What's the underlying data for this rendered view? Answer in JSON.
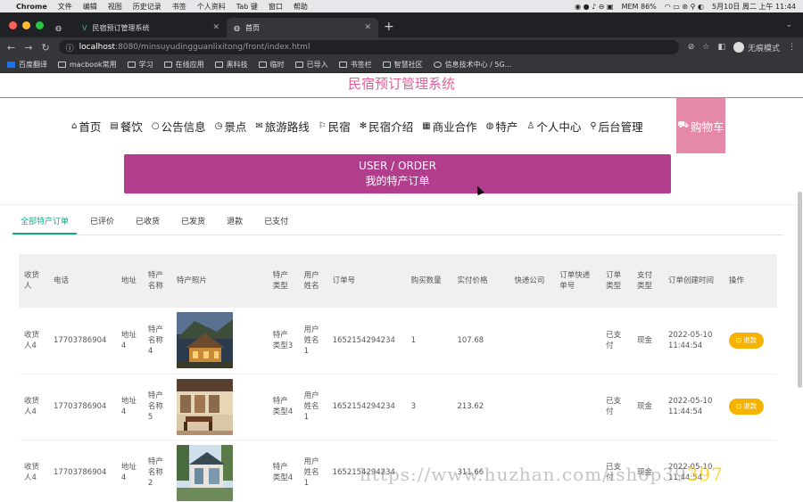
{
  "macbar": {
    "app": "Chrome",
    "menus": [
      "文件",
      "编辑",
      "视图",
      "历史记录",
      "书签",
      "个人资料",
      "Tab 键",
      "窗口",
      "帮助"
    ],
    "battery": "MEM 86%",
    "datetime": "5月10日 周二 上午 11:44"
  },
  "browser": {
    "tabs": [
      {
        "label": "民宿预订管理系统",
        "active": false
      },
      {
        "label": "首页",
        "active": true
      }
    ],
    "url_host": "localhost",
    "url_path": ":8080/minsuyudingguanlixitong/front/index.html",
    "incognito_label": "无痕模式",
    "bookmarks": [
      "百度翻译",
      "macbook常用",
      "学习",
      "在线应用",
      "黑科技",
      "临时",
      "已导入",
      "书签栏",
      "智慧社区",
      "信息技术中心 / 5G..."
    ]
  },
  "site": {
    "title": "民宿预订管理系统",
    "nav": [
      {
        "icon": "home-icon",
        "glyph": "⌂",
        "label": "首页"
      },
      {
        "icon": "food-icon",
        "glyph": "▤",
        "label": "餐饮"
      },
      {
        "icon": "notice-icon",
        "glyph": "○",
        "label": "公告信息"
      },
      {
        "icon": "scenic-icon",
        "glyph": "◷",
        "label": "景点"
      },
      {
        "icon": "route-icon",
        "glyph": "✉",
        "label": "旅游路线"
      },
      {
        "icon": "homestay-icon",
        "glyph": "⚐",
        "label": "民宿"
      },
      {
        "icon": "intro-icon",
        "glyph": "✻",
        "label": "民宿介绍"
      },
      {
        "icon": "business-icon",
        "glyph": "▦",
        "label": "商业合作"
      },
      {
        "icon": "specialty-icon",
        "glyph": "◍",
        "label": "特产"
      },
      {
        "icon": "user-icon",
        "glyph": "♙",
        "label": "个人中心"
      },
      {
        "icon": "admin-icon",
        "glyph": "⚲",
        "label": "后台管理"
      }
    ],
    "cart_label": "购物车",
    "banner_en": "USER / ORDER",
    "banner_cn": "我的特产订单"
  },
  "order_tabs": [
    "全部特产订单",
    "已评价",
    "已收货",
    "已发货",
    "退款",
    "已支付"
  ],
  "table": {
    "headers": [
      "收货人",
      "电话",
      "地址",
      "特产名称",
      "特产照片",
      "特产类型",
      "用户姓名",
      "订单号",
      "购买数量",
      "实付价格",
      "快递公司",
      "订单快递单号",
      "订单类型",
      "支付类型",
      "订单创建时间",
      "操作"
    ],
    "rows": [
      {
        "receiver": "收货人4",
        "phone": "17703786904",
        "address": "地址4",
        "name": "特产名称4",
        "photo": "house-photo-night",
        "type": "特产类型3",
        "user": "用户姓名1",
        "order_no": "1652154294234",
        "qty": "1",
        "price": "107.68",
        "courier": "",
        "tracking": "",
        "status": "已支付",
        "pay": "现金",
        "created": "2022-05-10 11:44:54",
        "action": "退款"
      },
      {
        "receiver": "收货人4",
        "phone": "17703786904",
        "address": "地址4",
        "name": "特产名称5",
        "photo": "terrace-photo",
        "type": "特产类型4",
        "user": "用户姓名1",
        "order_no": "1652154294234",
        "qty": "3",
        "price": "213.62",
        "courier": "",
        "tracking": "",
        "status": "已支付",
        "pay": "现金",
        "created": "2022-05-10 11:44:54",
        "action": "退款"
      },
      {
        "receiver": "收货人4",
        "phone": "17703786904",
        "address": "地址4",
        "name": "特产名称2",
        "photo": "cabin-photo",
        "type": "特产类型4",
        "user": "用户姓名1",
        "order_no": "1652154294234",
        "qty": "",
        "price": "311.66",
        "courier": "",
        "tracking": "",
        "status": "已支付",
        "pay": "现金",
        "created": "2022-05-10 11:44:54",
        "action": ""
      }
    ]
  },
  "watermark": {
    "text": "https://www.huzhan.com/ishop39",
    "num": "397"
  }
}
